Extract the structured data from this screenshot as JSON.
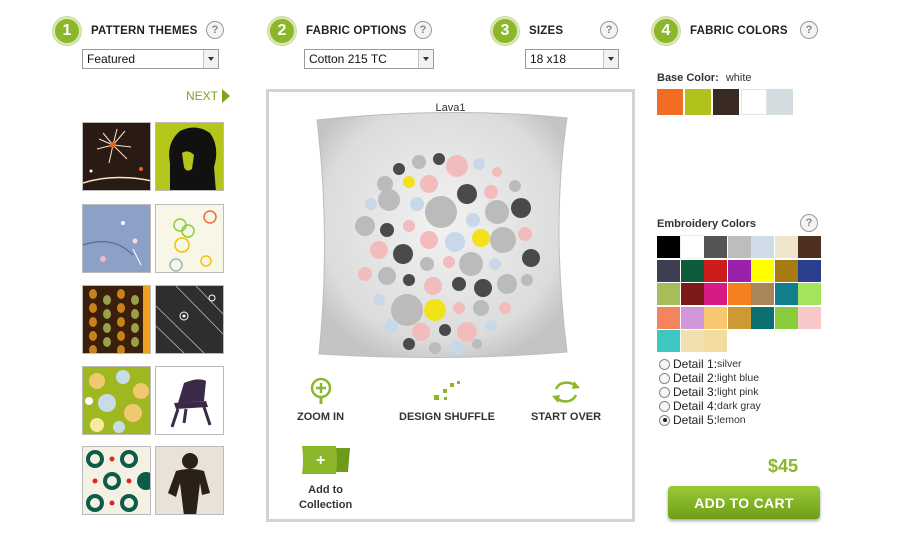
{
  "steps": [
    {
      "num": "1",
      "title": "PATTERN THEMES"
    },
    {
      "num": "2",
      "title": "FABRIC OPTIONS"
    },
    {
      "num": "3",
      "title": "SIZES"
    },
    {
      "num": "4",
      "title": "FABRIC COLORS"
    }
  ],
  "help_glyph": "?",
  "selects": {
    "theme": "Featured",
    "fabric": "Cotton 215 TC",
    "size": "18 x18"
  },
  "next_label": "NEXT",
  "thumbnails": [
    "dandelion-pattern",
    "portrait-pattern",
    "blue-floral-pattern",
    "cream-floral-pattern",
    "dotted-stripes-pattern",
    "dark-line-pattern",
    "circles-pattern",
    "chair-pattern",
    "geometric-pattern",
    "figure-pattern"
  ],
  "preview": {
    "name": "Lava1"
  },
  "tools": {
    "zoom": "ZOOM IN",
    "shuffle": "DESIGN SHUFFLE",
    "start_over": "START OVER",
    "add_line1": "Add to",
    "add_line2": "Collection"
  },
  "base_color": {
    "label": "Base Color:",
    "value": "white",
    "swatches": [
      "#f26d24",
      "#b1c21c",
      "#3a2a24",
      "#ffffff",
      "#d3dcdf"
    ]
  },
  "embroidery": {
    "label": "Embroidery Colors",
    "colors": [
      "#000000",
      "#ffffff",
      "#555555",
      "#bdbdbd",
      "#cfdce8",
      "#efe4cc",
      "#4d3020",
      "#3b3f50",
      "#0e5c3c",
      "#cc1c1c",
      "#9b21a8",
      "#ffff00",
      "#a87a14",
      "#2b3f8e",
      "#a6bd5a",
      "#7a1a1a",
      "#d61c84",
      "#f5801e",
      "#a8865a",
      "#11808c",
      "#a2e45c",
      "#f3845e",
      "#d196d8",
      "#f8c870",
      "#cc9933",
      "#0c7070",
      "#8bcc3c",
      "#f6c8c8",
      "#3cc8c0",
      "#f0e0b0",
      "#f2dca0"
    ]
  },
  "details": [
    {
      "label": "Detail 1:",
      "value": "silver",
      "selected": false
    },
    {
      "label": "Detail 2:",
      "value": "light blue",
      "selected": false
    },
    {
      "label": "Detail 3:",
      "value": "light pink",
      "selected": false
    },
    {
      "label": "Detail 4:",
      "value": "dark gray",
      "selected": false
    },
    {
      "label": "Detail 5:",
      "value": "lemon",
      "selected": true
    }
  ],
  "price": "$45",
  "cart_label": "ADD TO CART",
  "colors": {
    "accent_green": "#8db72b",
    "detail_silver": "#b4b4b4",
    "detail_lightblue": "#c8d8e8",
    "detail_lightpink": "#f2bcbc",
    "detail_darkgray": "#4a4a4a",
    "detail_lemon": "#f2e21a"
  }
}
